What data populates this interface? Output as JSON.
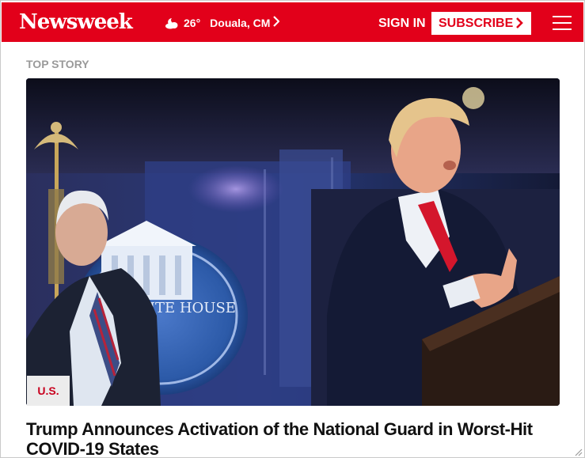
{
  "header": {
    "logo_text": "Newsweek",
    "weather": {
      "icon": "partly-cloudy-night-icon",
      "temperature": "26°",
      "location": "Douala, CM"
    },
    "signin_label": "SIGN IN",
    "subscribe_label": "SUBSCRIBE",
    "menu_icon": "hamburger-menu-icon"
  },
  "top_story": {
    "section_label": "TOP STORY",
    "category": "U.S.",
    "headline": "Trump Announces Activation of the National Guard in Worst-Hit COVID-19 States",
    "image_seal_text": "THE WHITE HOUSE"
  },
  "colors": {
    "brand_red": "#e2001a",
    "section_gray": "#9a9a9a",
    "category_red": "#c8001e",
    "category_bg": "#ececec"
  }
}
